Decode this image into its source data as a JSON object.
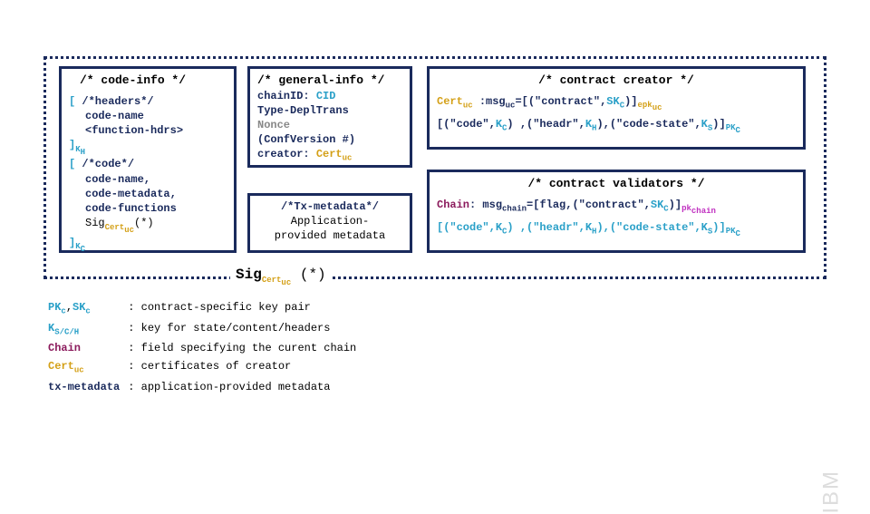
{
  "box1": {
    "title": "/* code-info */",
    "l1a": "[ ",
    "l1b": "/*headers*/",
    "l2": "code-name",
    "l3": "<function-hdrs>",
    "l4a": "]",
    "l4b": "K",
    "l4c": "H",
    "l5a": "[ ",
    "l5b": "/*code*/",
    "l6": "code-name,",
    "l7": "code-metadata,",
    "l8": "code-functions",
    "l9a": "Sig",
    "l9b": "Cert",
    "l9c": "uc",
    "l9d": "(*)",
    "l10a": "]",
    "l10b": "K",
    "l10c": "C"
  },
  "box2": {
    "title": "/* general-info */",
    "l1a": "chainID: ",
    "l1b": "CID",
    "l2": "Type-DeplTrans",
    "l3": "Nonce",
    "l4": "(ConfVersion #)",
    "l5a": "creator: ",
    "l5b": "Cert",
    "l5c": "uc"
  },
  "box3": {
    "title": "/*Tx-metadata*/",
    "l1": "Application-",
    "l2": "provided metadata"
  },
  "box4": {
    "title": "/* contract creator */",
    "l1a": "Cert",
    "l1b": "uc",
    "l1c": " :msg",
    "l1d": "uc",
    "l1e": "=[(\"contract\",",
    "l1f": "SK",
    "l1g": "C",
    "l1h": ")]",
    "l1i": "epk",
    "l1j": "uc",
    "l2a": "[(\"code\",",
    "l2b": "K",
    "l2c": "C",
    "l2d": ") ,(\"headr\",",
    "l2e": "K",
    "l2f": "H",
    "l2g": "),(\"code-state\",",
    "l2h": "K",
    "l2i": "S",
    "l2j": ")]",
    "l2k": "PK",
    "l2l": "C"
  },
  "box5": {
    "title": "/* contract validators */",
    "l1a": "Chain",
    "l1b": ": msg",
    "l1c": "chain",
    "l1d": "=[flag,(\"contract\",",
    "l1e": "SK",
    "l1f": "C",
    "l1g": ")]",
    "l1h": "pk",
    "l1i": "chain",
    "l2a": "[(\"code\",",
    "l2b": "K",
    "l2c": "C",
    "l2d": ") ,(\"headr\",",
    "l2e": "K",
    "l2f": "H",
    "l2g": "),(\"code-state\",",
    "l2h": "K",
    "l2i": "S",
    "l2j": ")]",
    "l2k": "PK",
    "l2l": "C"
  },
  "sig": {
    "a": "Sig",
    "b": "Cert",
    "c": "uc",
    "d": " (*)"
  },
  "legend": {
    "r1k1": "PK",
    "r1k2": "c",
    "r1k3": ",",
    "r1k4": "SK",
    "r1k5": "c",
    "r1v": ": contract-specific key pair",
    "r2k1": "K",
    "r2k2": "S/C/H",
    "r2v": ": key for state/content/headers",
    "r3k": "Chain",
    "r3v": ": field specifying the curent chain",
    "r4k1": "Cert",
    "r4k2": "uc",
    "r4v": ": certificates of creator",
    "r5k": "tx-metadata",
    "r5v": ": application-provided metadata"
  },
  "brand": "IBM"
}
